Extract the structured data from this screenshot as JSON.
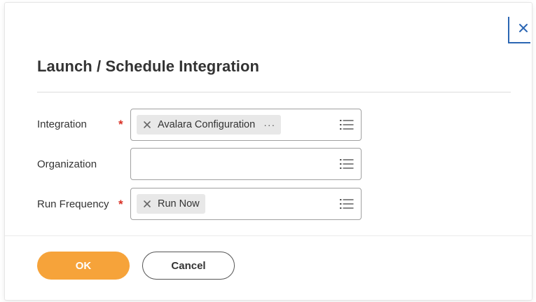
{
  "dialog": {
    "title": "Launch / Schedule Integration"
  },
  "fields": {
    "integration": {
      "label": "Integration",
      "required_mark": "*",
      "selected_value": "Avalara Configuration",
      "more_label": "···"
    },
    "organization": {
      "label": "Organization"
    },
    "run_frequency": {
      "label": "Run Frequency",
      "required_mark": "*",
      "selected_value": "Run Now"
    }
  },
  "footer": {
    "ok_label": "OK",
    "cancel_label": "Cancel"
  },
  "icons": {
    "close": "close-icon",
    "remove": "remove-x-icon",
    "prompt": "list-icon"
  },
  "colors": {
    "primary_button": "#f6a33a",
    "required": "#d93025",
    "close_accent": "#2b66b3"
  }
}
